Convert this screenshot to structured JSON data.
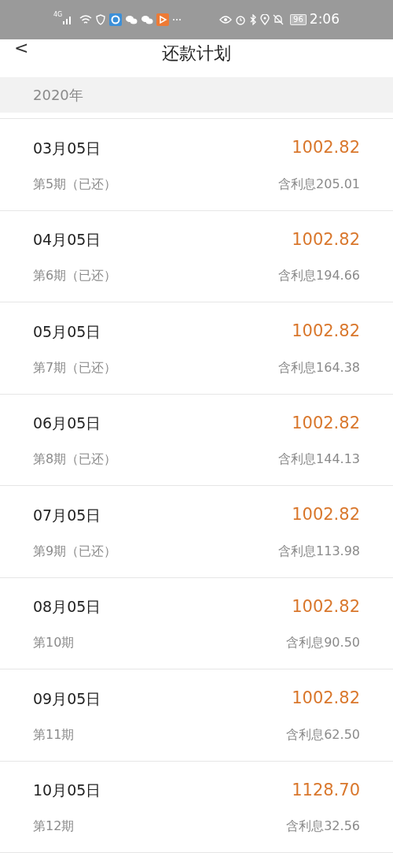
{
  "status_bar": {
    "network": "4G",
    "battery": "96",
    "time": "2:06"
  },
  "header": {
    "back": "<",
    "title": "还款计划"
  },
  "year": "2020年",
  "rows": [
    {
      "date": "03月05日",
      "amount": "1002.82",
      "period": "第5期（已还）",
      "interest": "含利息205.01"
    },
    {
      "date": "04月05日",
      "amount": "1002.82",
      "period": "第6期（已还）",
      "interest": "含利息194.66"
    },
    {
      "date": "05月05日",
      "amount": "1002.82",
      "period": "第7期（已还）",
      "interest": "含利息164.38"
    },
    {
      "date": "06月05日",
      "amount": "1002.82",
      "period": "第8期（已还）",
      "interest": "含利息144.13"
    },
    {
      "date": "07月05日",
      "amount": "1002.82",
      "period": "第9期（已还）",
      "interest": "含利息113.98"
    },
    {
      "date": "08月05日",
      "amount": "1002.82",
      "period": "第10期",
      "interest": "含利息90.50"
    },
    {
      "date": "09月05日",
      "amount": "1002.82",
      "period": "第11期",
      "interest": "含利息62.50"
    },
    {
      "date": "10月05日",
      "amount": "1128.70",
      "period": "第12期",
      "interest": "含利息32.56"
    }
  ]
}
